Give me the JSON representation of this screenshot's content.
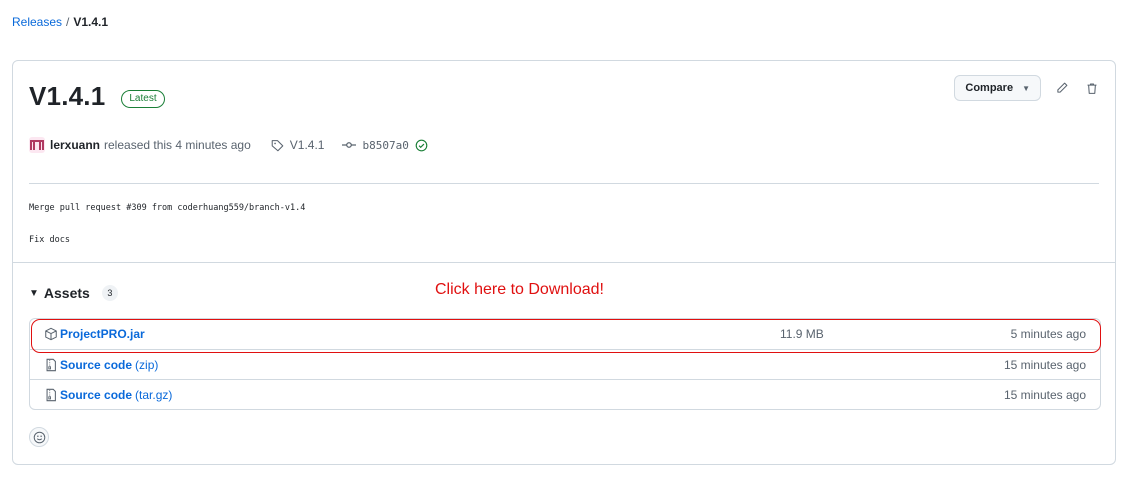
{
  "breadcrumb": {
    "root": "Releases",
    "separator": "/",
    "current": "V1.4.1"
  },
  "release": {
    "title": "V1.4.1",
    "badge": "Latest",
    "compare_label": "Compare",
    "author": "lerxuann",
    "released_text": "released this 4 minutes ago",
    "tag": "V1.4.1",
    "commit": "b8507a0",
    "body_lines": [
      "Merge pull request #309 from coderhuang559/branch-v1.4",
      "Fix docs"
    ]
  },
  "assets": {
    "heading": "Assets",
    "count": "3",
    "annotation": "Click here to Download!",
    "rows": [
      {
        "name": "ProjectPRO.jar",
        "sub": "",
        "size": "11.9 MB",
        "time": "5 minutes ago"
      },
      {
        "name": "Source code",
        "sub": "(zip)",
        "size": "",
        "time": "15 minutes ago"
      },
      {
        "name": "Source code",
        "sub": "(tar.gz)",
        "size": "",
        "time": "15 minutes ago"
      }
    ]
  },
  "colors": {
    "link": "#0969da",
    "success": "#1a7f37",
    "annotation": "#e01010",
    "border": "#d1d9e0"
  },
  "icons": [
    "tag-icon",
    "commit-icon",
    "verified-check-icon",
    "pencil-icon",
    "trash-icon",
    "package-icon",
    "file-zip-icon",
    "smiley-icon"
  ]
}
